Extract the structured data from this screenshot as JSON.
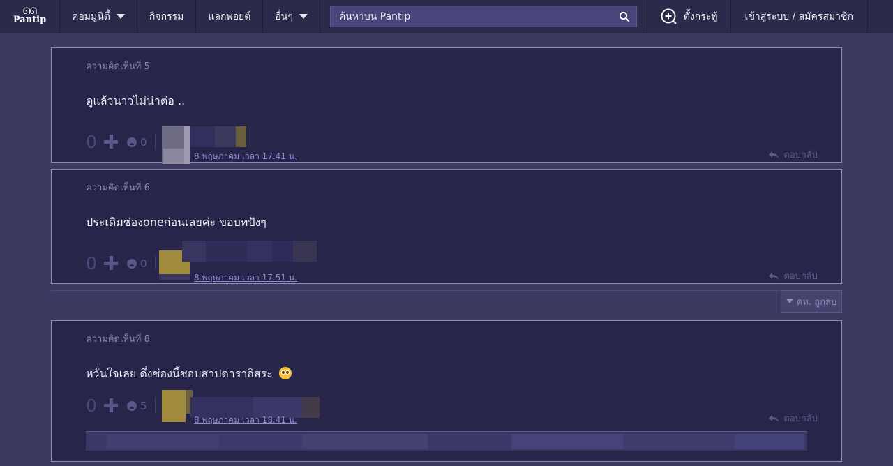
{
  "nav": {
    "logo_text": "Pantip",
    "logo_glyph": "ᘏᘏ",
    "items": [
      {
        "label": "คอมมูนิตี้",
        "has_caret": true
      },
      {
        "label": "กิจกรรม",
        "has_caret": false
      },
      {
        "label": "แลกพอยต์",
        "has_caret": false
      },
      {
        "label": "อื่นๆ",
        "has_caret": true
      }
    ],
    "search_placeholder": "ค้นหาบน Pantip",
    "new_topic_label": "ตั้งกระทู้",
    "login_label": "เข้าสู่ระบบ / สมัครสมาชิก"
  },
  "comments": [
    {
      "label": "ความคิดเห็นที่ 5",
      "body": "ดูแล้วนาวไม่น่าต่อ ..",
      "score": "0",
      "reaction_count": "0",
      "timestamp": "8 พฤษภาคม เวลา 17.41 น.",
      "reply_label": "ตอบกลับ"
    },
    {
      "label": "ความคิดเห็นที่ 6",
      "body": "ประเดิมช่องoneก่อนเลยค่ะ ขอบทปังๆ",
      "score": "0",
      "reaction_count": "0",
      "timestamp": "8 พฤษภาคม เวลา 17.51 น.",
      "reply_label": "ตอบกลับ"
    },
    {
      "label": "ความคิดเห็นที่ 8",
      "body": "หวั่นใจเลย ดึ่งช่องนี้ชอบสาปดาราอิสระ",
      "score": "0",
      "reaction_count": "5",
      "timestamp": "8 พฤษภาคม เวลา 18.41 น.",
      "reply_label": "ตอบกลับ"
    }
  ],
  "deleted_toggle_label": "คห. ถูกลบ",
  "colors": {
    "page_bg": "#3d3a61",
    "nav_bg": "#2c2a4b",
    "card_bg": "#27254a",
    "card_border": "#8f8cae",
    "link": "#8e8cd0"
  }
}
